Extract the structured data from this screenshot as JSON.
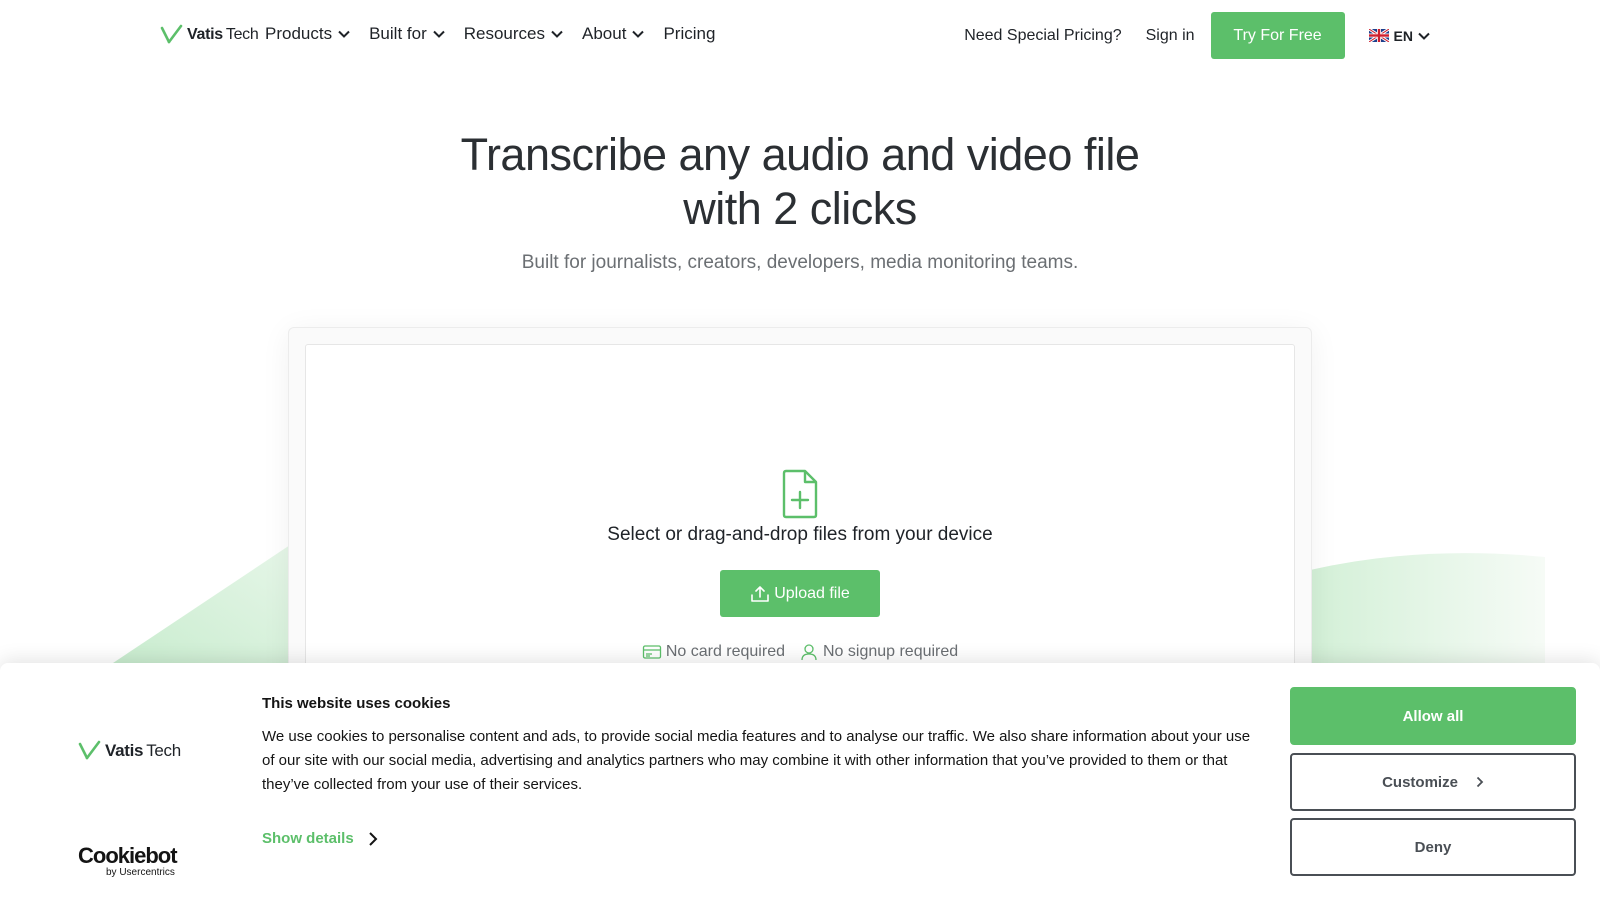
{
  "brand": {
    "name_bold": "Vatis",
    "name_light": "Tech",
    "accent": "#5cbf6a"
  },
  "nav": {
    "items": [
      {
        "label": "Products",
        "has_dropdown": true
      },
      {
        "label": "Built for",
        "has_dropdown": true
      },
      {
        "label": "Resources",
        "has_dropdown": true
      },
      {
        "label": "About",
        "has_dropdown": true
      },
      {
        "label": "Pricing",
        "has_dropdown": false
      }
    ],
    "special_pricing": "Need Special Pricing?",
    "sign_in": "Sign in",
    "try_free": "Try For Free",
    "language": "EN",
    "language_icon": "uk-flag-icon"
  },
  "hero": {
    "title_line1": "Transcribe any audio and video file",
    "title_line2": "with 2 clicks",
    "subtitle": "Built for journalists, creators, developers, media monitoring teams."
  },
  "upload": {
    "icon": "file-plus-icon",
    "prompt": "Select or drag-and-drop files from your device",
    "button": "Upload file",
    "badges": [
      {
        "icon": "credit-card-icon",
        "label": "No card required"
      },
      {
        "icon": "user-icon",
        "label": "No signup required"
      }
    ]
  },
  "cookie": {
    "title": "This website uses cookies",
    "text": "We use cookies to personalise content and ads, to provide social media features and to analyse our traffic. We also share information about your use of our site with our social media, advertising and analytics partners who may combine it with other information that you’ve provided to them or that they’ve collected from your use of their services.",
    "show_details": "Show details",
    "allow_all": "Allow all",
    "customize": "Customize",
    "deny": "Deny",
    "provider": "Cookiebot",
    "provider_sub": "by Usercentrics"
  }
}
